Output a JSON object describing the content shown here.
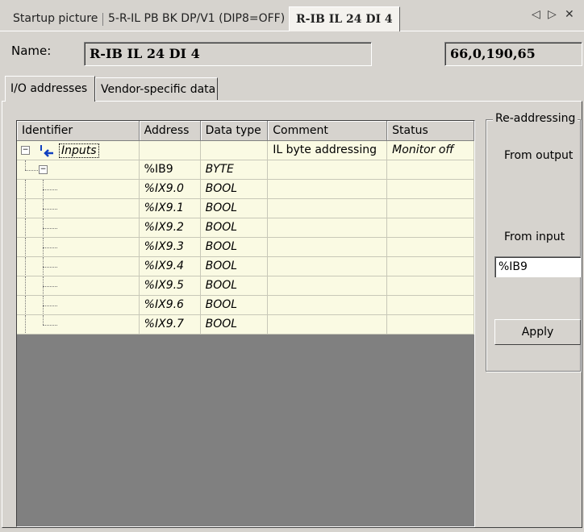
{
  "doc_tabs": [
    {
      "label": "Startup picture"
    },
    {
      "label": "5-R-IL PB BK DP/V1 (DIP8=OFF)"
    },
    {
      "label": "R-IB IL 24 DI 4"
    }
  ],
  "header": {
    "name_label": "Name:",
    "name_value": "R-IB IL 24 DI 4",
    "id_value": "66,0,190,65"
  },
  "inner_tabs": [
    {
      "label": "I/O addresses"
    },
    {
      "label": "Vendor-specific data"
    }
  ],
  "table": {
    "columns": [
      "Identifier",
      "Address",
      "Data type",
      "Comment",
      "Status"
    ],
    "rows": [
      {
        "identifier": "Inputs",
        "address": "",
        "type": "",
        "comment": "IL byte addressing",
        "status": "Monitor off"
      },
      {
        "identifier": "",
        "address": "%IB9",
        "type": "BYTE",
        "comment": "",
        "status": ""
      },
      {
        "identifier": "",
        "address": "%IX9.0",
        "type": "BOOL",
        "comment": "",
        "status": ""
      },
      {
        "identifier": "",
        "address": "%IX9.1",
        "type": "BOOL",
        "comment": "",
        "status": ""
      },
      {
        "identifier": "",
        "address": "%IX9.2",
        "type": "BOOL",
        "comment": "",
        "status": ""
      },
      {
        "identifier": "",
        "address": "%IX9.3",
        "type": "BOOL",
        "comment": "",
        "status": ""
      },
      {
        "identifier": "",
        "address": "%IX9.4",
        "type": "BOOL",
        "comment": "",
        "status": ""
      },
      {
        "identifier": "",
        "address": "%IX9.5",
        "type": "BOOL",
        "comment": "",
        "status": ""
      },
      {
        "identifier": "",
        "address": "%IX9.6",
        "type": "BOOL",
        "comment": "",
        "status": ""
      },
      {
        "identifier": "",
        "address": "%IX9.7",
        "type": "BOOL",
        "comment": "",
        "status": ""
      }
    ]
  },
  "readdressing": {
    "title": "Re-addressing",
    "from_output": "From output",
    "from_input": "From input",
    "input_value": "%IB9",
    "apply_label": "Apply"
  },
  "icons": {
    "nav_left": "◁",
    "nav_right": "▷",
    "close": "✕",
    "collapse": "−"
  },
  "colors": {
    "window_bg": "#d6d3ce",
    "row_bg": "#fafae3",
    "grid_empty": "#808080"
  }
}
